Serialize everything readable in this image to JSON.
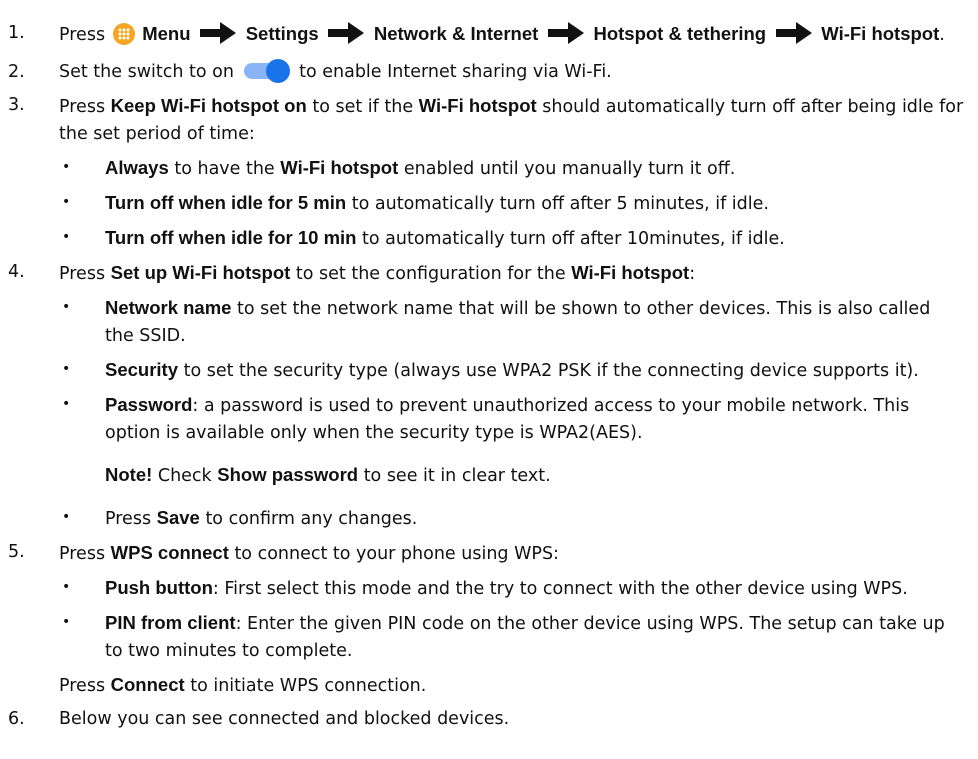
{
  "step1": {
    "num": "1.",
    "press": "Press",
    "menu": "Menu",
    "settings": "Settings",
    "network": "Network & Internet",
    "hotspot_tethering": "Hotspot & tethering",
    "wifi_hotspot": "Wi-Fi hotspot",
    "end": "."
  },
  "step2": {
    "num": "2.",
    "pre": "Set the switch to on",
    "post": "to enable Internet sharing via Wi-Fi."
  },
  "step3": {
    "num": "3.",
    "press": "Press",
    "keep": "Keep Wi-Fi hotspot on",
    "mid": "to set if the",
    "wifi_hotspot": "Wi-Fi hotspot",
    "post": "should automatically turn off after being idle for the set period of time:",
    "bullets": [
      {
        "bold": "Always",
        "text_a": "to have the",
        "bold2": "Wi-Fi hotspot",
        "text_b": "enabled until you manually turn it off."
      },
      {
        "bold": "Turn off when idle for 5 min",
        "text": "to automatically turn off after 5 minutes, if idle."
      },
      {
        "bold": "Turn off when idle for 10 min",
        "text": "to automatically turn off after 10minutes, if idle."
      }
    ]
  },
  "step4": {
    "num": "4.",
    "press": "Press",
    "setup": "Set up Wi-Fi hotspot",
    "mid": "to set the configuration for the",
    "wifi_hotspot": "Wi-Fi hotspot",
    "end": ":",
    "bullets": [
      {
        "bold": "Network name",
        "text": "to set the network name that will be shown to other devices. This is also called the SSID."
      },
      {
        "bold": "Security",
        "text": "to set the security type (always use WPA2 PSK if the connecting device supports it)."
      },
      {
        "bold": "Password",
        "text": ": a password is used to prevent unauthorized access to your mobile network. This option is available only when the security type is WPA2(AES)."
      }
    ],
    "note": {
      "label": "Note!",
      "text_a": "Check",
      "bold": "Show password",
      "text_b": "to see it in clear text."
    },
    "save": {
      "press": "Press",
      "bold": "Save",
      "text": "to confirm any changes."
    }
  },
  "step5": {
    "num": "5.",
    "press": "Press",
    "wps": "WPS connect",
    "post": "to connect to your phone using WPS:",
    "bullets": [
      {
        "bold": "Push button",
        "text": ": First select this mode and the try to connect with the other device using WPS."
      },
      {
        "bold": "PIN from client",
        "text": ": Enter the given PIN code on the other device using WPS. The setup can take up to two minutes to complete."
      }
    ],
    "connect": {
      "press": "Press",
      "bold": "Connect",
      "text": "to initiate WPS connection."
    }
  },
  "step6": {
    "num": "6.",
    "text": "Below you can see connected and blocked devices."
  },
  "icons": {
    "menu": "apps-grid-icon",
    "arrow": "right-arrow-icon",
    "toggle": "toggle-switch-on-icon"
  },
  "colors": {
    "menu_icon": "#F5A623",
    "toggle_track": "#8AB4F8",
    "toggle_knob": "#1A73E8"
  }
}
